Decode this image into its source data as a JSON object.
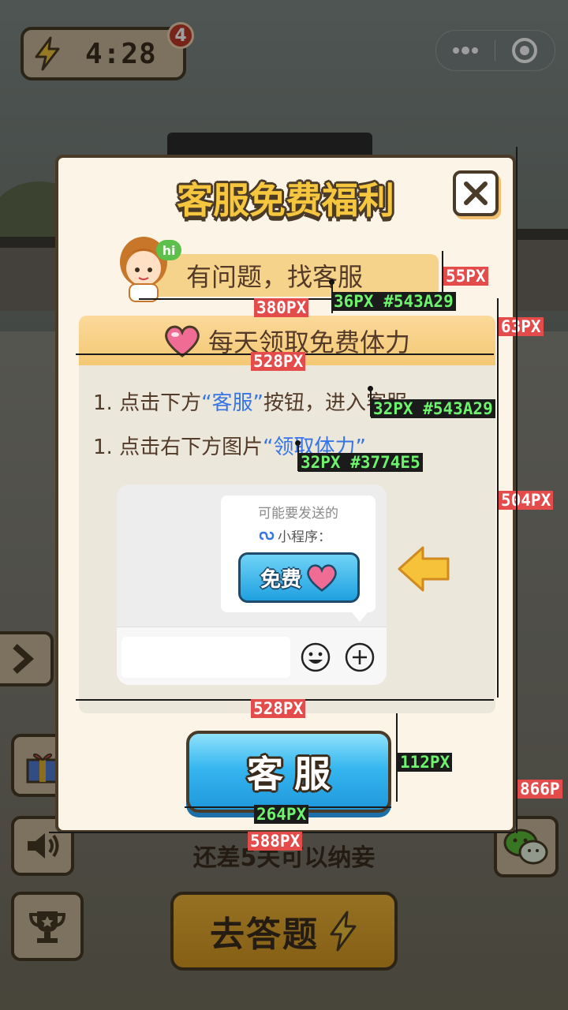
{
  "hud": {
    "energy_time": "4:28",
    "energy_badge": "4"
  },
  "game": {
    "remaining_text": "还差5关可以纳妾",
    "answer_button": "去答题"
  },
  "modal": {
    "title": "客服免费福利",
    "service_prompt": "有问题，找客服",
    "hi_badge": "hi",
    "panel_title": "每天领取免费体力",
    "step1": {
      "pre": "1. 点击下方",
      "highlight": "“客服”",
      "post": "按钮，进入客服"
    },
    "step2": {
      "pre": "1. 点击右下方图片",
      "highlight": "“领取体力”"
    },
    "chat": {
      "hint": "可能要发送的",
      "mini_label": "小程序：",
      "free_label": "免费"
    },
    "service_button": "客服"
  },
  "annotations": {
    "service_height": "55PX",
    "service_width": "380PX",
    "service_font": "36PX #543A29",
    "panel_head_height": "63PX",
    "panel_width_top": "528PX",
    "step_font": "32PX #543A29",
    "highlight_font": "32PX #3774E5",
    "panel_height": "504PX",
    "panel_width_bottom": "528PX",
    "button_height": "112PX",
    "button_width": "264PX",
    "modal_width": "588PX",
    "modal_height": "866P"
  },
  "colors": {
    "text_brown": "#543A29",
    "highlight_blue": "#3774E5",
    "title_yellow": "#f5c63e",
    "border_dark": "#4a3a28"
  }
}
